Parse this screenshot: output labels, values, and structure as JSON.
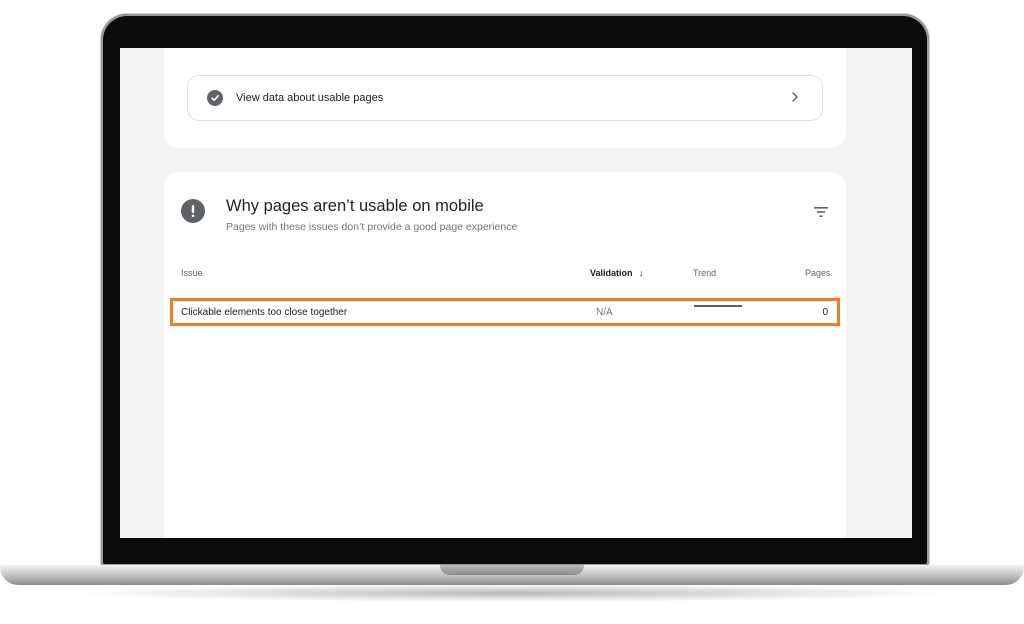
{
  "usable_card": {
    "link_label": "View data about usable pages",
    "check_icon": "check-circle-icon",
    "chevron_icon": "chevron-right-icon"
  },
  "issues_card": {
    "title": "Why pages aren’t usable on mobile",
    "subtitle": "Pages with these issues don’t provide a good page experience",
    "alert_icon": "exclamation-circle-icon",
    "filter_icon": "filter-icon",
    "table": {
      "columns": [
        "Issue",
        "Validation",
        "Trend",
        "Pages"
      ],
      "sort_indicator": "↓",
      "rows": [
        {
          "issue": "Clickable elements too close together",
          "validation": "N/A",
          "pages": "0"
        }
      ]
    }
  },
  "colors": {
    "highlight": "#ef7d22",
    "icon_grey": "#5f6368",
    "screen_bg": "#f4f4f4"
  }
}
